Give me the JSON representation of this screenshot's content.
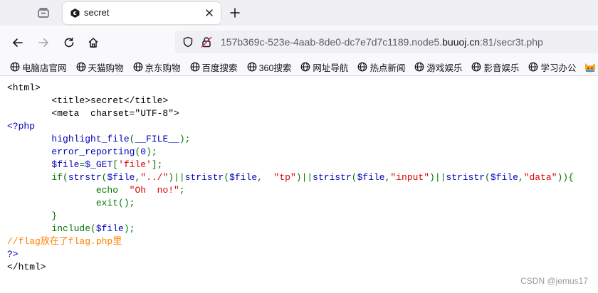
{
  "tab": {
    "title": "secret"
  },
  "address_bar": {
    "url_prefix": "157b369c-523e-4aab-8de0-dc7e7d7c1189.node5.",
    "url_host": "buuoj.cn",
    "url_suffix": ":81/secr3t.php"
  },
  "bookmarks": [
    {
      "label": "电脑店官网",
      "icon": "globe-icon"
    },
    {
      "label": "天猫购物",
      "icon": "globe-icon"
    },
    {
      "label": "京东购物",
      "icon": "globe-icon"
    },
    {
      "label": "百度搜索",
      "icon": "globe-icon"
    },
    {
      "label": "360搜索",
      "icon": "globe-icon"
    },
    {
      "label": "网址导航",
      "icon": "globe-icon"
    },
    {
      "label": "热点新闻",
      "icon": "globe-icon"
    },
    {
      "label": "游戏娱乐",
      "icon": "globe-icon"
    },
    {
      "label": "影音娱乐",
      "icon": "globe-icon"
    },
    {
      "label": "学习办公",
      "icon": "globe-icon"
    }
  ],
  "colors": {
    "php_default": "#0000bb",
    "php_keyword": "#007700",
    "php_string": "#dd0000",
    "php_comment": "#ff8000",
    "html_text": "#000000"
  },
  "source_lines": [
    [
      {
        "t": "<html>",
        "c": "html"
      }
    ],
    [
      {
        "t": "        <title>secret</title>",
        "c": "html"
      }
    ],
    [
      {
        "t": "        <meta  charset=\"UTF-8\">",
        "c": "html"
      }
    ],
    [
      {
        "t": "<?php",
        "c": "default"
      }
    ],
    [
      {
        "t": "        highlight_file",
        "c": "default"
      },
      {
        "t": "(",
        "c": "keyword"
      },
      {
        "t": "__FILE__",
        "c": "default"
      },
      {
        "t": ");",
        "c": "keyword"
      }
    ],
    [
      {
        "t": "        error_reporting",
        "c": "default"
      },
      {
        "t": "(",
        "c": "keyword"
      },
      {
        "t": "0",
        "c": "default"
      },
      {
        "t": ");",
        "c": "keyword"
      }
    ],
    [
      {
        "t": "        $file",
        "c": "default"
      },
      {
        "t": "=",
        "c": "keyword"
      },
      {
        "t": "$_GET",
        "c": "default"
      },
      {
        "t": "[",
        "c": "keyword"
      },
      {
        "t": "'file'",
        "c": "string"
      },
      {
        "t": "];",
        "c": "keyword"
      }
    ],
    [
      {
        "t": "        if(",
        "c": "keyword"
      },
      {
        "t": "strstr",
        "c": "default"
      },
      {
        "t": "(",
        "c": "keyword"
      },
      {
        "t": "$file",
        "c": "default"
      },
      {
        "t": ",",
        "c": "keyword"
      },
      {
        "t": "\"../\"",
        "c": "string"
      },
      {
        "t": ")||",
        "c": "keyword"
      },
      {
        "t": "stristr",
        "c": "default"
      },
      {
        "t": "(",
        "c": "keyword"
      },
      {
        "t": "$file",
        "c": "default"
      },
      {
        "t": ",  ",
        "c": "keyword"
      },
      {
        "t": "\"tp\"",
        "c": "string"
      },
      {
        "t": ")||",
        "c": "keyword"
      },
      {
        "t": "stristr",
        "c": "default"
      },
      {
        "t": "(",
        "c": "keyword"
      },
      {
        "t": "$file",
        "c": "default"
      },
      {
        "t": ",",
        "c": "keyword"
      },
      {
        "t": "\"input\"",
        "c": "string"
      },
      {
        "t": ")||",
        "c": "keyword"
      },
      {
        "t": "stristr",
        "c": "default"
      },
      {
        "t": "(",
        "c": "keyword"
      },
      {
        "t": "$file",
        "c": "default"
      },
      {
        "t": ",",
        "c": "keyword"
      },
      {
        "t": "\"data\"",
        "c": "string"
      },
      {
        "t": ")){",
        "c": "keyword"
      }
    ],
    [
      {
        "t": "                echo  ",
        "c": "keyword"
      },
      {
        "t": "\"Oh  no!\"",
        "c": "string"
      },
      {
        "t": ";",
        "c": "keyword"
      }
    ],
    [
      {
        "t": "                exit();",
        "c": "keyword"
      }
    ],
    [
      {
        "t": "        }",
        "c": "keyword"
      }
    ],
    [
      {
        "t": "        include(",
        "c": "keyword"
      },
      {
        "t": "$file",
        "c": "default"
      },
      {
        "t": ");",
        "c": "keyword"
      }
    ],
    [
      {
        "t": "//flag放在了flag.php里",
        "c": "comment"
      }
    ],
    [
      {
        "t": "?>",
        "c": "default"
      }
    ],
    [
      {
        "t": "</html>",
        "c": "html"
      }
    ]
  ],
  "watermark": "CSDN @jemus17"
}
